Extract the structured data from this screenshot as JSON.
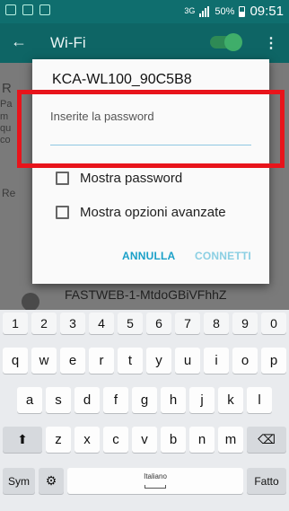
{
  "status_bar": {
    "network_type": "3G",
    "battery_percent": "50%",
    "time": "09:51"
  },
  "appbar": {
    "title": "Wi-Fi"
  },
  "background": {
    "visible_network": "FASTWEB-1-MtdoGBiVFhhZ",
    "partial_letters": [
      "R",
      "Pa",
      "m",
      "qu",
      "co",
      "Re"
    ]
  },
  "dialog": {
    "title": "KCA-WL100_90C5B8",
    "password_label": "Inserite la password",
    "password_value": "",
    "show_password_label": "Mostra password",
    "show_advanced_label": "Mostra opzioni avanzate",
    "cancel_label": "ANNULLA",
    "connect_label": "CONNETTI",
    "accent_color": "#1aa0c8"
  },
  "keyboard": {
    "number_row": [
      "1",
      "2",
      "3",
      "4",
      "5",
      "6",
      "7",
      "8",
      "9",
      "0"
    ],
    "row1": [
      "q",
      "w",
      "e",
      "r",
      "t",
      "y",
      "u",
      "i",
      "o",
      "p"
    ],
    "row2": [
      "a",
      "s",
      "d",
      "f",
      "g",
      "h",
      "j",
      "k",
      "l"
    ],
    "row3": [
      "z",
      "x",
      "c",
      "v",
      "b",
      "n",
      "m"
    ],
    "sym_label": "Sym",
    "space_label": "Italiano",
    "period_label": ".",
    "done_label": "Fatto"
  },
  "annotation_color": "#e8141b"
}
